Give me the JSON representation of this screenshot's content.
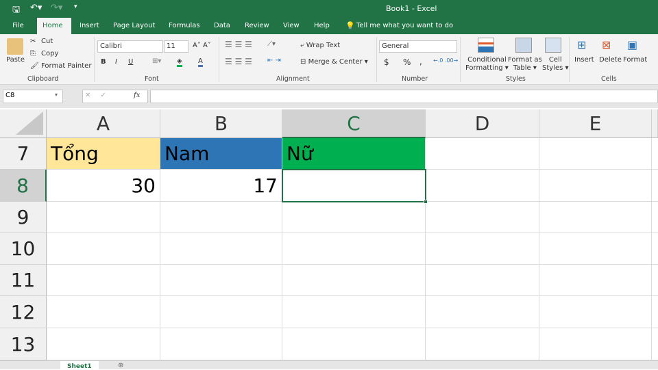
{
  "title": "Book1  -  Excel",
  "tabs": [
    "File",
    "Home",
    "Insert",
    "Page Layout",
    "Formulas",
    "Data",
    "Review",
    "View",
    "Help"
  ],
  "tell_me": "Tell me what you want to do",
  "clipboard": {
    "paste": "Paste",
    "cut": "Cut",
    "copy": "Copy",
    "format_painter": "Format Painter",
    "label": "Clipboard"
  },
  "font": {
    "name": "Calibri",
    "size": "11",
    "bold": "B",
    "italic": "I",
    "underline": "U",
    "label": "Font"
  },
  "alignment": {
    "wrap": "Wrap Text",
    "merge": "Merge & Center",
    "label": "Alignment"
  },
  "number": {
    "format": "General",
    "currency": "$",
    "percent": "%",
    "comma": ",",
    "label": "Number"
  },
  "styles": {
    "conditional": "Conditional",
    "conditional2": "Formatting",
    "format_table": "Format as",
    "format_table2": "Table",
    "cell_styles": "Cell",
    "cell_styles2": "Styles",
    "label": "Styles"
  },
  "cells": {
    "insert": "Insert",
    "delete": "Delete",
    "format": "Format",
    "label": "Cells"
  },
  "formula_bar": {
    "name_box": "C8",
    "fx": "fx",
    "value": ""
  },
  "columns": [
    "A",
    "B",
    "C",
    "D",
    "E"
  ],
  "rows": [
    "7",
    "8",
    "9",
    "10",
    "11",
    "12",
    "13"
  ],
  "cells_data": {
    "A7": "Tổng",
    "B7": "Nam",
    "C7": "Nữ",
    "A8": "30",
    "B8": "17"
  },
  "colors": {
    "A7": "#ffe699",
    "B7": "#2e75b6",
    "C7": "#00b050",
    "excel_green": "#217346"
  },
  "sheet_tab": "Sheet1"
}
